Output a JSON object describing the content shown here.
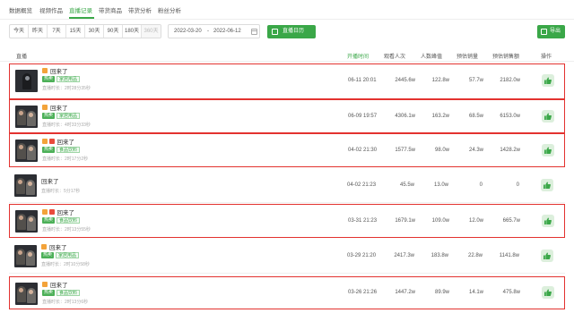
{
  "tabs": [
    {
      "label": "数据概览"
    },
    {
      "label": "视频作品"
    },
    {
      "label": "直播记录"
    },
    {
      "label": "带货商品"
    },
    {
      "label": "带货分析"
    },
    {
      "label": "粉丝分析"
    }
  ],
  "range_chips": [
    "今天",
    "昨天",
    "7天",
    "15天",
    "30天",
    "90天",
    "180天",
    "360天"
  ],
  "date_range": {
    "start": "2022-03-20",
    "separator": "-",
    "end": "2022-06-12"
  },
  "buttons": {
    "calendar": "直播日历",
    "export": "导出"
  },
  "columns": {
    "live": "直播",
    "start_time": "开播时间",
    "viewers": "观看人次",
    "peak": "人数峰值",
    "sales_volume": "预估销量",
    "sales_amount": "预估销售额",
    "action": "操作"
  },
  "rows": [
    {
      "title": "回来了",
      "hot": "热卖",
      "category": "家居用品",
      "duration": "直播时长：2时28分35秒",
      "start_time": "06-11 20:01",
      "viewers": "2445.6w",
      "peak": "122.8w",
      "sales_volume": "57.7w",
      "sales_amount": "2182.0w"
    },
    {
      "title": "回来了",
      "hot": "热卖",
      "category": "家居用品",
      "duration": "直播时长：4时33分33秒",
      "start_time": "06-09 19:57",
      "viewers": "4306.1w",
      "peak": "163.2w",
      "sales_volume": "68.5w",
      "sales_amount": "6153.0w"
    },
    {
      "title": "回来了",
      "hot": "热卖",
      "category": "食品饮料",
      "duration": "直播时长：2时17分2秒",
      "start_time": "04-02 21:30",
      "viewers": "1577.5w",
      "peak": "98.0w",
      "sales_volume": "24.3w",
      "sales_amount": "1428.2w"
    },
    {
      "title": "回来了",
      "hot": "",
      "category": "",
      "duration": "直播时长：5分17秒",
      "start_time": "04-02 21:23",
      "viewers": "45.5w",
      "peak": "13.0w",
      "sales_volume": "0",
      "sales_amount": "0"
    },
    {
      "title": "回来了",
      "hot": "热卖",
      "category": "食品饮料",
      "duration": "直播时长：2时13分55秒",
      "start_time": "03-31 21:23",
      "viewers": "1679.1w",
      "peak": "109.0w",
      "sales_volume": "12.0w",
      "sales_amount": "665.7w"
    },
    {
      "title": "回来了",
      "hot": "热卖",
      "category": "家居用品",
      "duration": "直播时长：2时10分58秒",
      "start_time": "03-29 21:20",
      "viewers": "2417.3w",
      "peak": "183.8w",
      "sales_volume": "22.8w",
      "sales_amount": "1141.8w"
    },
    {
      "title": "回来了",
      "hot": "热卖",
      "category": "食品饮料",
      "duration": "直播时长：2时13分6秒",
      "start_time": "03-26 21:26",
      "viewers": "1447.2w",
      "peak": "89.9w",
      "sales_volume": "14.1w",
      "sales_amount": "475.8w"
    }
  ]
}
